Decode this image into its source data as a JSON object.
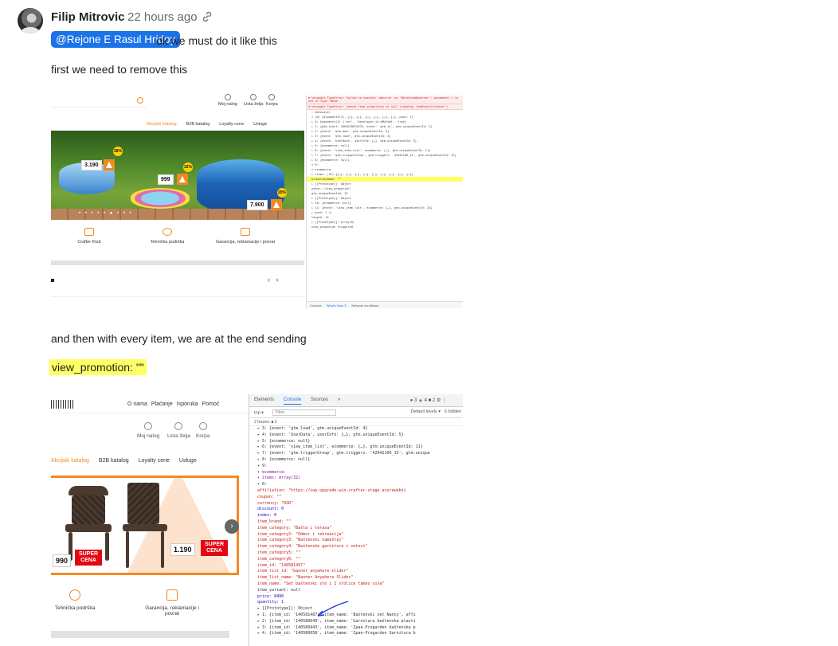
{
  "post": {
    "author": "Filip Mitrovic",
    "time": "22 hours ago",
    "mention": "@Rejone E Rasul Hridoy",
    "after_mention": "ok we must do it like this",
    "line1": "first we need to remove this",
    "line2": "and then with every item, we are at the end sending",
    "highlight": "view_promotion: \"\""
  },
  "shot1": {
    "topnav": [
      "Moj nalog",
      "Lista želja",
      "Korpa"
    ],
    "menu": [
      "Akcijski katalog",
      "B2B katalog",
      "Loyalty cene",
      "Usluge"
    ],
    "prices": [
      "3.190",
      "999",
      "7.900"
    ],
    "discounts": [
      "28%",
      "32%",
      "20%"
    ],
    "services": [
      "Crafter Klub",
      "Tehnička podrška",
      "Garancija, reklamacije i povrat"
    ],
    "devtools_errors": [
      "✖ Uncaught TypeError: Failed to  execute 'observe' on 'MutationObserver': parameter 1 is not of type 'Node'.",
      "✖ Uncaught TypeError: Cannot read properties of null (reading 'addEventListener')"
    ],
    "devtools_lines": [
      "› dataLayer",
      "▾ (6) [Arguments(3), {…}, {…}, {…}, {…}, {…}, {…}, push: f]",
      "  ▸ 0: Arguments(3) ['set', 'developer_id.dMzYxNj', true]",
      "  ▸ 1: {gtm.start: 1663078075933, event: 'gtm.js', gtm.uniqueEventId: 2}",
      "  ▸ 2: {event: 'gtm.dom', gtm.uniqueEventId: 9}",
      "  ▸ 3: {event: 'gtm.load', gtm.uniqueEventId: 4}",
      "  ▸ 4: {event: 'UserData', userInfo: {…}, gtm.uniqueEventId: 5}",
      "  ▸ 5: {ecommerce: null}",
      "  ▸ 6: {event: 'view_item_list', ecommerce: {…}, gtm.uniqueEventId: 11}",
      "  ▸ 7: {event: 'gtm.triggerGroup', gtm.triggers: '42042106_15', gtm.uniqueEventId: 12}",
      "  ▸ 8: {ecommerce: null}",
      "  ▾ 9:",
      "    ▾ ecommerce:",
      "      ▸ items: (32) [{…}, {…}, {…}, {…}, {…}, {…}, {…}, {…}, {…}]",
      "        promotionName: \"\"",
      "      ▸ [[Prototype]]: Object",
      "      event: \"view_promotion\"",
      "      gtm.uniqueEventId: 13",
      "    ▸ [[Prototype]]: Object",
      "  ▸ 10: {ecommerce: null}",
      "  ▸ 11: {event: 'view_item_list', ecommerce: {…}, gtm.uniqueEventId: 14}",
      "  ▸ push: f ()",
      "    length: 12",
      "  ▸ [[Prototype]]: Array(0)",
      "view_promotion triggered"
    ],
    "devtools_tabs": [
      "Console",
      "What's New ✕",
      "Network conditions"
    ]
  },
  "shot2": {
    "topmenu": [
      "O nama",
      "Plaćanje",
      "Isporuka",
      "Pomoć"
    ],
    "navicons": [
      "Moj nalog",
      "Lista želja",
      "Korpa"
    ],
    "menu": [
      "Akcijski katalog",
      "B2B katalog",
      "Loyalty cene",
      "Usluge"
    ],
    "prices": [
      "990",
      "1.190"
    ],
    "super_cena": "SUPER CENA",
    "services": [
      "Tehnička podrška",
      "Garancija, reklamacije i povrat"
    ],
    "devtools_tabs": [
      "Elements",
      "Console",
      "Sources",
      "»"
    ],
    "devtools_badges": "● 3  ▲ 4  ■ 2  ⚙  ⋮",
    "filter_top": "top ▾",
    "filter_placeholder": "Filter",
    "default_levels": "Default levels ▾",
    "hidden": "6 hidden",
    "issues": "2 Issues: ■ 2",
    "code": [
      "▸ 3: {event: 'gtm.load', gtm.uniqueEventId: 4}",
      "▸ 4: {event: 'UserData', userInfo: {…}, gtm.uniqueEventId: 5}",
      "▸ 5: {ecommerce: null}",
      "▸ 6: {event: 'view_item_list', ecommerce: {…}, gtm.uniqueEventId: 11}",
      "▸ 7: {event: 'gtm.triggerGroup', gtm.triggers: '42042106_15', gtm.unique",
      "▸ 8: {ecommerce: null}",
      "▾ 9:",
      "  ▾ ecommerce:",
      "    ▾ items: Array(32)",
      "      ▾ 0:",
      "          affiliation: \"https://sop-upgrade-win-crafter-stage.azurewebsi",
      "          coupon: \"\"",
      "          currency: \"RSD\"",
      "          discount: 0",
      "          index: 0",
      "          item_brand: \"\"",
      "          item_category: \"Bašta i terasa\"",
      "          item_category2: \"Odmor i rekreacija\"",
      "          item_category3: \"Baštenski nameštaj\"",
      "          item_category4: \"Baštenske garniture i setovi\"",
      "          item_category5: \"\"",
      "          item_category6: \"\"",
      "          item_id: \"140581497\"",
      "          item_list_id: \"banner_anywhere-slider\"",
      "          item_list_name: \"Banner Anywhere Slider\"",
      "          item_name: \"Set baštenski sto i 2 stolice tamno siva\"",
      "          item_variant: null",
      "          price: 8490",
      "          quantity: 1",
      "        ▸ [[Prototype]]: Object",
      "      ▸ 1: {item_id: '140581487', item_name: 'Baštenski set Nancy', affi",
      "      ▸ 2: {item_id: '140580049', item_name: 'Garnitura baštenska plasti",
      "      ▸ 3: {item_id: '140580443', item_name: 'Ipae-Progarden baštenska p",
      "      ▸ 4: {item_id: '140580058', item_name: 'Ipae-Progarden Garnitura b"
    ]
  }
}
